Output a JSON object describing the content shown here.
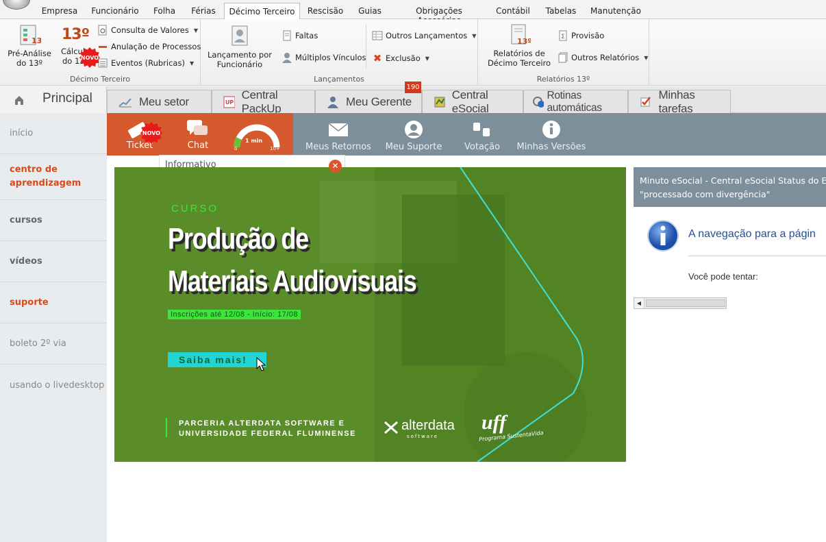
{
  "ribbon": {
    "tabs": [
      "Empresa",
      "Funcionário",
      "Folha",
      "Férias",
      "Décimo Terceiro",
      "Rescisão",
      "Guias",
      "Obrigações Acessórias",
      "Contábil",
      "Tabelas",
      "Manutenção"
    ],
    "active_tab": "Décimo Terceiro",
    "groups": {
      "decimo": {
        "label": "Décimo Terceiro",
        "pre_analise": "Pré-Análise do 13º",
        "calculo": "Cálculo do 13º",
        "calc_icon_text": "13º",
        "consulta": "Consulta de Valores",
        "anulacao": "Anulação de Processos",
        "eventos": "Eventos (Rubricas)"
      },
      "lancamentos": {
        "label": "Lançamentos",
        "lanc_func": "Lançamento por Funcionário",
        "faltas": "Faltas",
        "multiplos": "Múltiplos Vínculos",
        "outros": "Outros Lançamentos",
        "exclusao": "Exclusão"
      },
      "relatorios": {
        "label": "Relatórios 13º",
        "relatorios": "Relatórios de Décimo Terceiro",
        "provisao": "Provisão",
        "outros": "Outros Relatórios"
      }
    }
  },
  "tabstrip": {
    "home": "Principal",
    "tabs": [
      "Meu setor",
      "Central PackUp",
      "Meu Gerente",
      "Central eSocial",
      "Rotinas automáticas",
      "Minhas tarefas"
    ],
    "gerente_badge": "190"
  },
  "sidebar": {
    "items": [
      "início",
      "centro de aprendizagem",
      "cursos",
      "vídeos",
      "suporte",
      "boleto 2º via",
      "usando o livedesktop"
    ],
    "novo_badge": "NOVO"
  },
  "support": {
    "ticket": "Ticket",
    "chat": "Chat",
    "gauge_label": "1 min",
    "gauge_min": "0",
    "gauge_max": "10+",
    "novo": "NOVO",
    "meus_retornos": "Meus Retornos",
    "meu_suporte": "Meu Suporte",
    "votacao": "Votação",
    "minhas_versoes": "Minhas Versões"
  },
  "informativo": "Informativo",
  "banner": {
    "kicker": "CURSO",
    "title_line1": "Produção de",
    "title_line2": "Materiais Audiovisuais",
    "dates": "Inscrições até 12/08 - Início: 17/08",
    "cta": "Saiba mais!",
    "partner_line1": "PARCERIA ALTERDATA SOFTWARE E",
    "partner_line2": "UNIVERSIDADE FEDERAL FLUMINENSE",
    "alterdata": "alterdata",
    "alterdata_sub": "software",
    "uff": "uff",
    "uff_sub": "Programa SustentaVida"
  },
  "right_panel": {
    "header_line1": "Minuto eSocial - Central eSocial Status do Ev",
    "header_line2": "\"processado com divergência\"",
    "nav_msg": "A navegação para a págin",
    "try_msg": "Você pode tentar:"
  },
  "colors": {
    "orange": "#d45a2e",
    "slate": "#7d8f9b",
    "banner_green": "#5a8c2a",
    "accent_red": "#d94a1a"
  }
}
